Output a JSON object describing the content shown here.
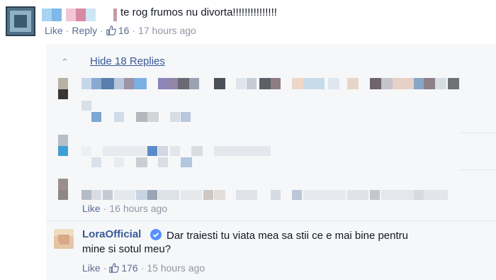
{
  "top_comment": {
    "text": "te rog frumos nu divorta!!!!!!!!!!!!!!!",
    "like_label": "Like",
    "reply_label": "Reply",
    "like_count": "16",
    "time": "17 hours ago"
  },
  "replies": {
    "toggle_label": "Hide 18 Replies",
    "blurred_reply_meta": {
      "like_label": "Like",
      "time": "16 hours ago"
    },
    "lora_reply": {
      "author": "LoraOfficial",
      "text_line1": "Dar traiesti tu viata mea sa stii ce e mai bine pentru",
      "text_line2": "mine si sotul meu?",
      "like_label": "Like",
      "like_count": "176",
      "time": "15 hours ago"
    }
  },
  "colors": {
    "link_blue": "#3b5998",
    "meta_gray": "#9197a3",
    "panel_bg": "#f6f7f9",
    "verified_blue": "#5890ff"
  },
  "icons": [
    "thumbs-up-icon",
    "chevron-up-icon",
    "verified-badge-icon"
  ]
}
